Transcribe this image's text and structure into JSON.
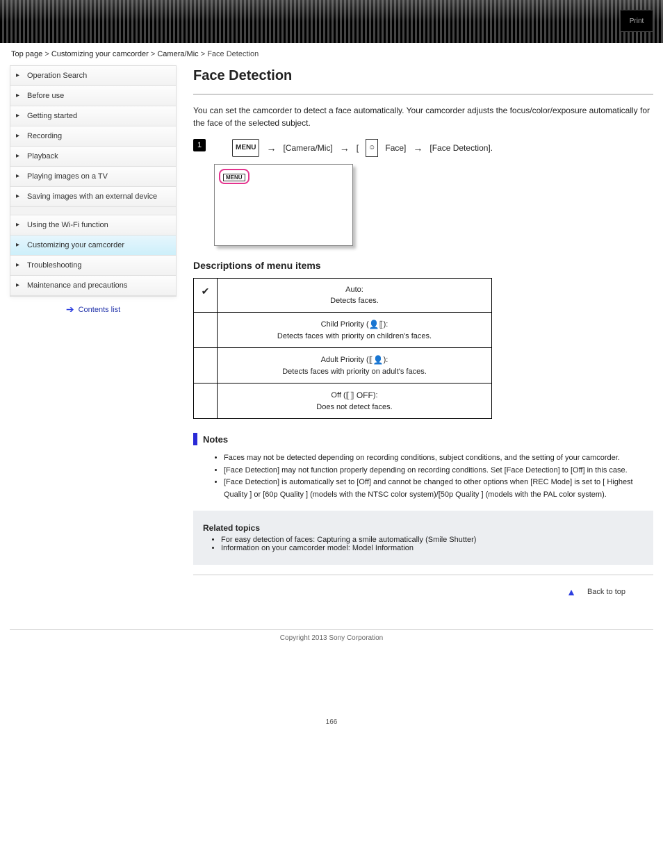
{
  "top": {
    "print": "Print"
  },
  "breadcrumb": {
    "a": "Top page",
    "b": "Customizing your camcorder",
    "c": "Camera/Mic",
    "d": "Face Detection"
  },
  "sidebar": {
    "items": [
      {
        "label": "Operation Search"
      },
      {
        "label": "Before use"
      },
      {
        "label": "Getting started"
      },
      {
        "label": "Recording"
      },
      {
        "label": "Playback"
      },
      {
        "label": "Playing images on a TV"
      },
      {
        "label": "Saving images with an external device"
      },
      {
        "label": "Using the Wi-Fi function"
      },
      {
        "label": "Customizing your camcorder"
      },
      {
        "label": "Troubleshooting"
      },
      {
        "label": "Maintenance and precautions"
      }
    ],
    "back_label": "Contents list"
  },
  "content": {
    "title": "Face Detection",
    "intro": "You can set the camcorder to detect a face automatically. Your camcorder adjusts the focus/color/exposure automatically for the face of the selected subject.",
    "step1_num": "1",
    "step1_seg1": "[Camera/Mic]",
    "step1_seg2": "[",
    "step1_seg3": "Face]",
    "step1_seg4": "[Face Detection].",
    "menu_text": "MENU",
    "options_heading": "Descriptions of menu items",
    "opts": [
      {
        "check": "✔",
        "label": "Auto:",
        "desc": "Detects faces."
      },
      {
        "check": "",
        "label": "Child Priority",
        "iconText": "👤⟦",
        "line2": "):",
        "desc": "Detects faces with priority on children's faces."
      },
      {
        "check": "",
        "label": "Adult Priority",
        "iconText": "⟦👤",
        "line2": "):",
        "desc": "Detects faces with priority on adult's faces."
      },
      {
        "check": "",
        "label": "Off (",
        "iconText": "⟦⟧\nOFF",
        "line2": "):",
        "desc": "Does not detect faces."
      }
    ],
    "notes_heading": "Notes",
    "notes": [
      "Faces may not be detected depending on recording conditions, subject conditions, and the setting of your camcorder.",
      "[Face Detection] may not function properly depending on recording conditions. Set [Face Detection] to [Off] in this case.",
      "[Face Detection] is automatically set to [Off] and cannot be changed to other options when [REC Mode] is set to [ Highest Quality   ] or [60p Quality    ] (models with the NTSC color system)/[50p Quality    ] (models with the PAL color system)."
    ],
    "related_heading": "Related topics",
    "related_items": [
      "For easy detection of faces: Capturing a smile automatically (Smile Shutter)",
      "Information on your camcorder model: Model Information"
    ]
  },
  "footer": {
    "back": "Back to top",
    "copyright": "Copyright 2013 Sony Corporation",
    "page": "166"
  }
}
